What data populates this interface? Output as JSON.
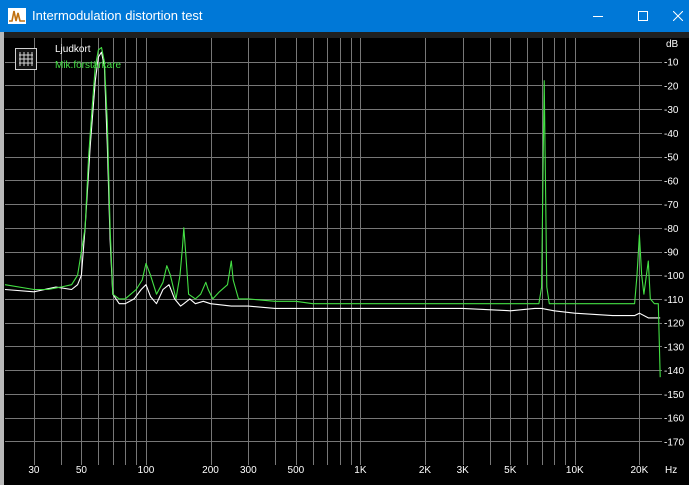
{
  "window": {
    "title": "Intermodulation distortion test",
    "app_icon": "waveform-icon",
    "controls": [
      "minimize-icon",
      "maximize-icon",
      "close-icon"
    ]
  },
  "chart_data": {
    "type": "line",
    "title": "",
    "x_unit_label": "Hz",
    "y_unit_label": "dB",
    "x_scale": "log",
    "xlim": [
      22,
      25500
    ],
    "ylim": [
      -180,
      0
    ],
    "grid": true,
    "legend_placement": "top-left",
    "x_ticks": [
      {
        "value": 30,
        "label": "30"
      },
      {
        "value": 50,
        "label": "50"
      },
      {
        "value": 100,
        "label": "100"
      },
      {
        "value": 200,
        "label": "200"
      },
      {
        "value": 300,
        "label": "300"
      },
      {
        "value": 500,
        "label": "500"
      },
      {
        "value": 1000,
        "label": "1K"
      },
      {
        "value": 2000,
        "label": "2K"
      },
      {
        "value": 3000,
        "label": "3K"
      },
      {
        "value": 5000,
        "label": "5K"
      },
      {
        "value": 10000,
        "label": "10K"
      },
      {
        "value": 20000,
        "label": "20K"
      }
    ],
    "y_ticks": [
      "-10",
      "-20",
      "-30",
      "-40",
      "-50",
      "-60",
      "-70",
      "-80",
      "-90",
      "-100",
      "-110",
      "-120",
      "-130",
      "-140",
      "-150",
      "-160",
      "-170"
    ],
    "series": [
      {
        "name": "Ljudkort",
        "color": "#ffffff",
        "points": [
          [
            22,
            -106
          ],
          [
            30,
            -107
          ],
          [
            38,
            -105
          ],
          [
            45,
            -106
          ],
          [
            48,
            -104
          ],
          [
            50,
            -100
          ],
          [
            52,
            -80
          ],
          [
            55,
            -45
          ],
          [
            58,
            -18
          ],
          [
            60,
            -8
          ],
          [
            62,
            -6
          ],
          [
            64,
            -12
          ],
          [
            66,
            -45
          ],
          [
            68,
            -85
          ],
          [
            70,
            -108
          ],
          [
            75,
            -112
          ],
          [
            80,
            -112
          ],
          [
            88,
            -110
          ],
          [
            95,
            -106
          ],
          [
            100,
            -104
          ],
          [
            105,
            -109
          ],
          [
            112,
            -112
          ],
          [
            120,
            -106
          ],
          [
            128,
            -104
          ],
          [
            136,
            -110
          ],
          [
            145,
            -113
          ],
          [
            150,
            -112
          ],
          [
            160,
            -110
          ],
          [
            170,
            -112
          ],
          [
            185,
            -111
          ],
          [
            200,
            -112
          ],
          [
            250,
            -113
          ],
          [
            300,
            -113
          ],
          [
            400,
            -114
          ],
          [
            500,
            -114
          ],
          [
            700,
            -114
          ],
          [
            1000,
            -114
          ],
          [
            2000,
            -114
          ],
          [
            3000,
            -114
          ],
          [
            5000,
            -115
          ],
          [
            6500,
            -114
          ],
          [
            7000,
            -114
          ],
          [
            8000,
            -115
          ],
          [
            10000,
            -116
          ],
          [
            15000,
            -117
          ],
          [
            19000,
            -117
          ],
          [
            20000,
            -116
          ],
          [
            22000,
            -118
          ],
          [
            25000,
            -118
          ]
        ]
      },
      {
        "name": "Mik.förstärkare",
        "color": "#44e044",
        "points": [
          [
            22,
            -104
          ],
          [
            30,
            -106
          ],
          [
            35,
            -106
          ],
          [
            40,
            -105
          ],
          [
            45,
            -104
          ],
          [
            48,
            -100
          ],
          [
            50,
            -90
          ],
          [
            52,
            -80
          ],
          [
            54,
            -50
          ],
          [
            56,
            -30
          ],
          [
            58,
            -12
          ],
          [
            60,
            -5
          ],
          [
            62,
            -4
          ],
          [
            64,
            -10
          ],
          [
            66,
            -35
          ],
          [
            68,
            -80
          ],
          [
            70,
            -108
          ],
          [
            75,
            -110
          ],
          [
            80,
            -110
          ],
          [
            90,
            -106
          ],
          [
            96,
            -102
          ],
          [
            100,
            -95
          ],
          [
            105,
            -100
          ],
          [
            112,
            -108
          ],
          [
            120,
            -103
          ],
          [
            125,
            -96
          ],
          [
            130,
            -100
          ],
          [
            138,
            -110
          ],
          [
            144,
            -100
          ],
          [
            148,
            -88
          ],
          [
            150,
            -80
          ],
          [
            153,
            -90
          ],
          [
            158,
            -108
          ],
          [
            170,
            -110
          ],
          [
            180,
            -108
          ],
          [
            190,
            -103
          ],
          [
            195,
            -106
          ],
          [
            205,
            -110
          ],
          [
            220,
            -107
          ],
          [
            240,
            -104
          ],
          [
            250,
            -94
          ],
          [
            255,
            -102
          ],
          [
            270,
            -110
          ],
          [
            300,
            -110
          ],
          [
            400,
            -111
          ],
          [
            500,
            -111
          ],
          [
            600,
            -112
          ],
          [
            700,
            -112
          ],
          [
            1000,
            -112
          ],
          [
            1500,
            -112
          ],
          [
            2000,
            -112
          ],
          [
            3000,
            -112
          ],
          [
            5000,
            -112
          ],
          [
            6800,
            -112
          ],
          [
            7000,
            -105
          ],
          [
            7200,
            -18
          ],
          [
            7400,
            -105
          ],
          [
            7600,
            -112
          ],
          [
            9000,
            -112
          ],
          [
            12000,
            -112
          ],
          [
            16000,
            -112
          ],
          [
            19000,
            -112
          ],
          [
            19500,
            -100
          ],
          [
            20000,
            -83
          ],
          [
            20500,
            -100
          ],
          [
            21000,
            -108
          ],
          [
            22000,
            -94
          ],
          [
            22500,
            -110
          ],
          [
            23500,
            -112
          ],
          [
            24500,
            -112
          ],
          [
            25000,
            -143
          ]
        ]
      }
    ]
  }
}
